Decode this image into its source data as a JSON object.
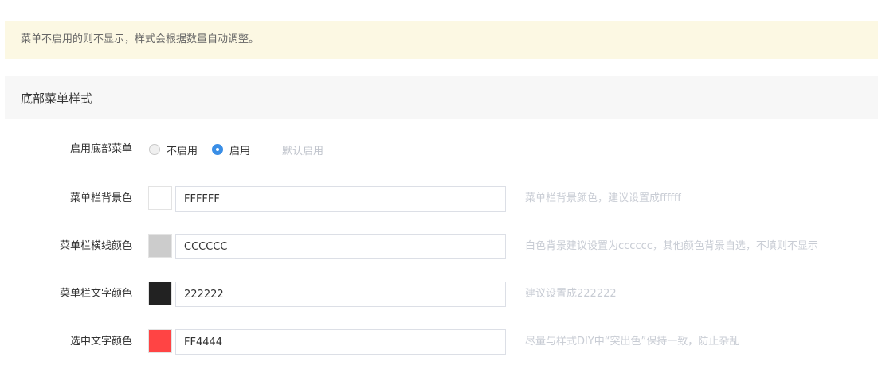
{
  "notice": {
    "text": "菜单不启用的则不显示，样式会根据数量自动调整。"
  },
  "section": {
    "title": "底部菜单样式"
  },
  "enable_menu": {
    "label": "启用底部菜单",
    "options": [
      {
        "label": "不启用",
        "checked": false
      },
      {
        "label": "启用",
        "checked": true
      }
    ],
    "hint": "默认启用"
  },
  "fields": [
    {
      "label": "菜单栏背景色",
      "value": "FFFFFF",
      "swatch_color": "#FFFFFF",
      "help": "菜单栏背景颜色，建议设置成ffffff"
    },
    {
      "label": "菜单栏横线颜色",
      "value": "CCCCCC",
      "swatch_color": "#CCCCCC",
      "help": "白色背景建议设置为cccccc，其他颜色背景自选，不填则不显示"
    },
    {
      "label": "菜单栏文字颜色",
      "value": "222222",
      "swatch_color": "#222222",
      "help": "建议设置成222222"
    },
    {
      "label": "选中文字颜色",
      "value": "FF4444",
      "swatch_color": "#FF4444",
      "help": "尽量与样式DIY中“突出色”保持一致，防止杂乱"
    }
  ]
}
